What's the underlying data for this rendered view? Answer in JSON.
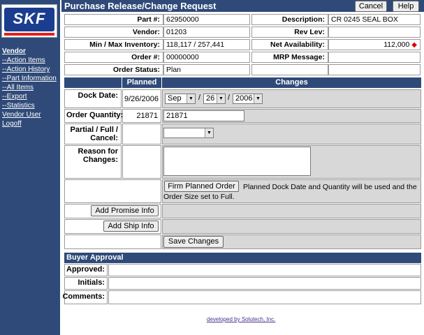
{
  "app": {
    "title": "Purchase Release/Change Request",
    "cancel_label": "Cancel",
    "help_label": "Help",
    "logo_text": "SKF"
  },
  "sidebar": {
    "items": [
      {
        "label": "Vendor"
      },
      {
        "label": "--Action Items"
      },
      {
        "label": "--Action History"
      },
      {
        "label": "--Part Information"
      },
      {
        "label": "--All Items"
      },
      {
        "label": "--Export"
      },
      {
        "label": "--Statistics"
      },
      {
        "label": "Vendor User"
      },
      {
        "label": "Logoff"
      }
    ]
  },
  "info": {
    "part_label": "Part #:",
    "part_value": "62950000",
    "description_label": "Description:",
    "description_value": "CR 0245 SEAL BOX",
    "vendor_label": "Vendor:",
    "vendor_value": "01203",
    "revlev_label": "Rev Lev:",
    "revlev_value": "",
    "minmax_label": "Min / Max Inventory:",
    "minmax_value": "118,117 / 257,441",
    "netavail_label": "Net Availability:",
    "netavail_value": "112,000",
    "netavail_marker": "◆",
    "order_label": "Order #:",
    "order_value": "00000000",
    "mrp_label": "MRP Message:",
    "mrp_value": "",
    "status_label": "Order Status:",
    "status_value": "Plan"
  },
  "changes": {
    "planned_header": "Planned",
    "changes_header": "Changes",
    "dock_date_label": "Dock Date:",
    "dock_date_planned": "9/26/2006",
    "month": "Sep",
    "day": "26",
    "year": "2006",
    "date_sep": "/",
    "order_qty_label": "Order Quantity:",
    "order_qty_planned": "21871",
    "order_qty_value": "21871",
    "partial_label": "Partial / Full / Cancel:",
    "partial_value": "",
    "reason_label": "Reason for Changes:",
    "reason_value": "",
    "firm_button": "Firm Planned Order",
    "firm_note": "Planned Dock Date and Quantity will be used and the Order Size set to Full.",
    "promise_button": "Add Promise Info",
    "ship_button": "Add Ship Info",
    "save_button": "Save Changes"
  },
  "approval": {
    "header": "Buyer Approval",
    "approved_label": "Approved:",
    "approved_value": "",
    "initials_label": "Initials:",
    "initials_value": "",
    "comments_label": "Comments:",
    "comments_value": ""
  },
  "footer": {
    "text": "developed by Solutech, Inc."
  }
}
